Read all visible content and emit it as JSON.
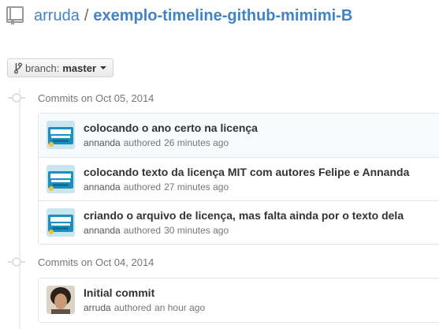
{
  "repo": {
    "owner": "arruda",
    "separator": "/",
    "name": "exemplo-timeline-github-mimimi-B"
  },
  "branch": {
    "label": "branch:",
    "value": "master"
  },
  "days": [
    {
      "label": "Commits on Oct 05, 2014",
      "commits": [
        {
          "title": "colocando o ano certo na licença",
          "author": "annanda",
          "verb": "authored",
          "time": "26 minutes ago",
          "avatar": "annanda-avatar"
        },
        {
          "title": "colocando texto da licença MIT com autores Felipe e Annanda",
          "author": "annanda",
          "verb": "authored",
          "time": "27 minutes ago",
          "avatar": "annanda-avatar"
        },
        {
          "title": "criando o arquivo de licença, mas falta ainda por o texto dela",
          "author": "annanda",
          "verb": "authored",
          "time": "30 minutes ago",
          "avatar": "annanda-avatar"
        }
      ]
    },
    {
      "label": "Commits on Oct 04, 2014",
      "commits": [
        {
          "title": "Initial commit",
          "author": "arruda",
          "verb": "authored",
          "time": "an hour ago",
          "avatar": "arruda-avatar"
        }
      ]
    }
  ],
  "colors": {
    "link": "#4183c4",
    "muted": "#767676",
    "border": "#e5e5e5"
  },
  "icons": {
    "repo": "repo-book-icon",
    "branch": "git-branch-icon",
    "caret": "caret-down-icon",
    "timeline": "commit-dot-icon"
  }
}
